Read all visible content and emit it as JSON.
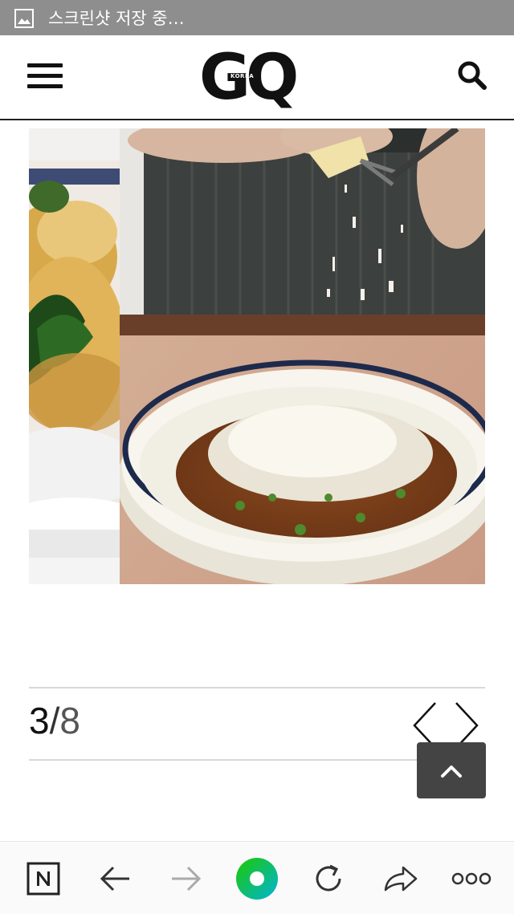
{
  "status_bar": {
    "notification_text": "스크린샷 저장 중…",
    "notification_icon": "image-icon"
  },
  "header": {
    "menu_icon": "hamburger-menu-icon",
    "logo_text": "GQ",
    "logo_subtext": "KOREA",
    "search_icon": "search-icon"
  },
  "gallery": {
    "previous_slide": "food-photo-partial",
    "current_slide": "pasta-bolognese-with-grated-parmesan"
  },
  "pager": {
    "current": "3",
    "separator": "/",
    "total": "8",
    "prev_icon": "chevron-left-icon",
    "next_icon": "chevron-right-icon",
    "scroll_top_icon": "chevron-up-icon"
  },
  "toolbar": {
    "items": [
      "naver-n-icon",
      "back-arrow-icon",
      "forward-arrow-icon",
      "green-dot-home-icon",
      "refresh-icon",
      "share-icon",
      "more-icon"
    ],
    "accent": "#1ec800"
  }
}
